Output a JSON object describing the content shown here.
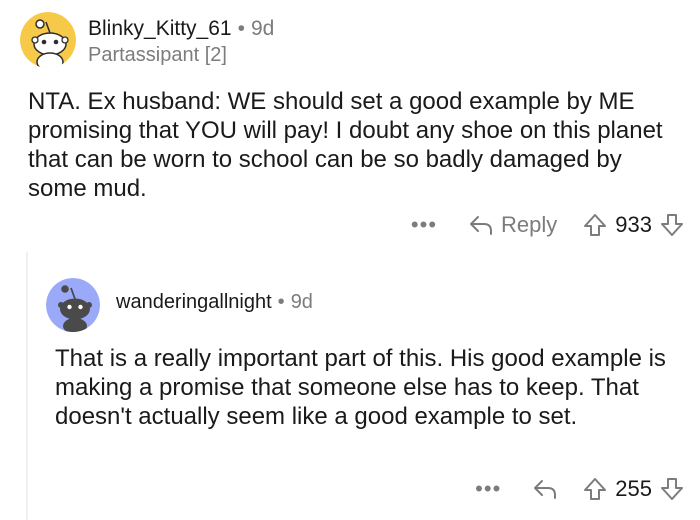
{
  "comments": [
    {
      "username": "Blinky_Kitty_61",
      "separator": "•",
      "age": "9d",
      "flair": "Partassipant [2]",
      "text": "NTA. Ex husband: WE should set a good example by ME promising that YOU will pay! I doubt any shoe on this planet that can be worn to school can be so badly damaged by some mud.",
      "more": "•••",
      "reply_label": "Reply",
      "score": "933",
      "avatar_bg": "#f7c948"
    },
    {
      "username": "wanderingallnight",
      "separator": "•",
      "age": "9d",
      "text": "That is a really important part of this. His good example is making a promise that someone else has to keep.  That doesn't actually seem like a good example to set.",
      "more": "•••",
      "score": "255",
      "avatar_bg": "#9aaaf8"
    }
  ],
  "icons": {
    "avatar": "reddit-snoo-icon",
    "reply": "reply-arrow-icon",
    "upvote": "upvote-arrow-icon",
    "downvote": "downvote-arrow-icon"
  }
}
